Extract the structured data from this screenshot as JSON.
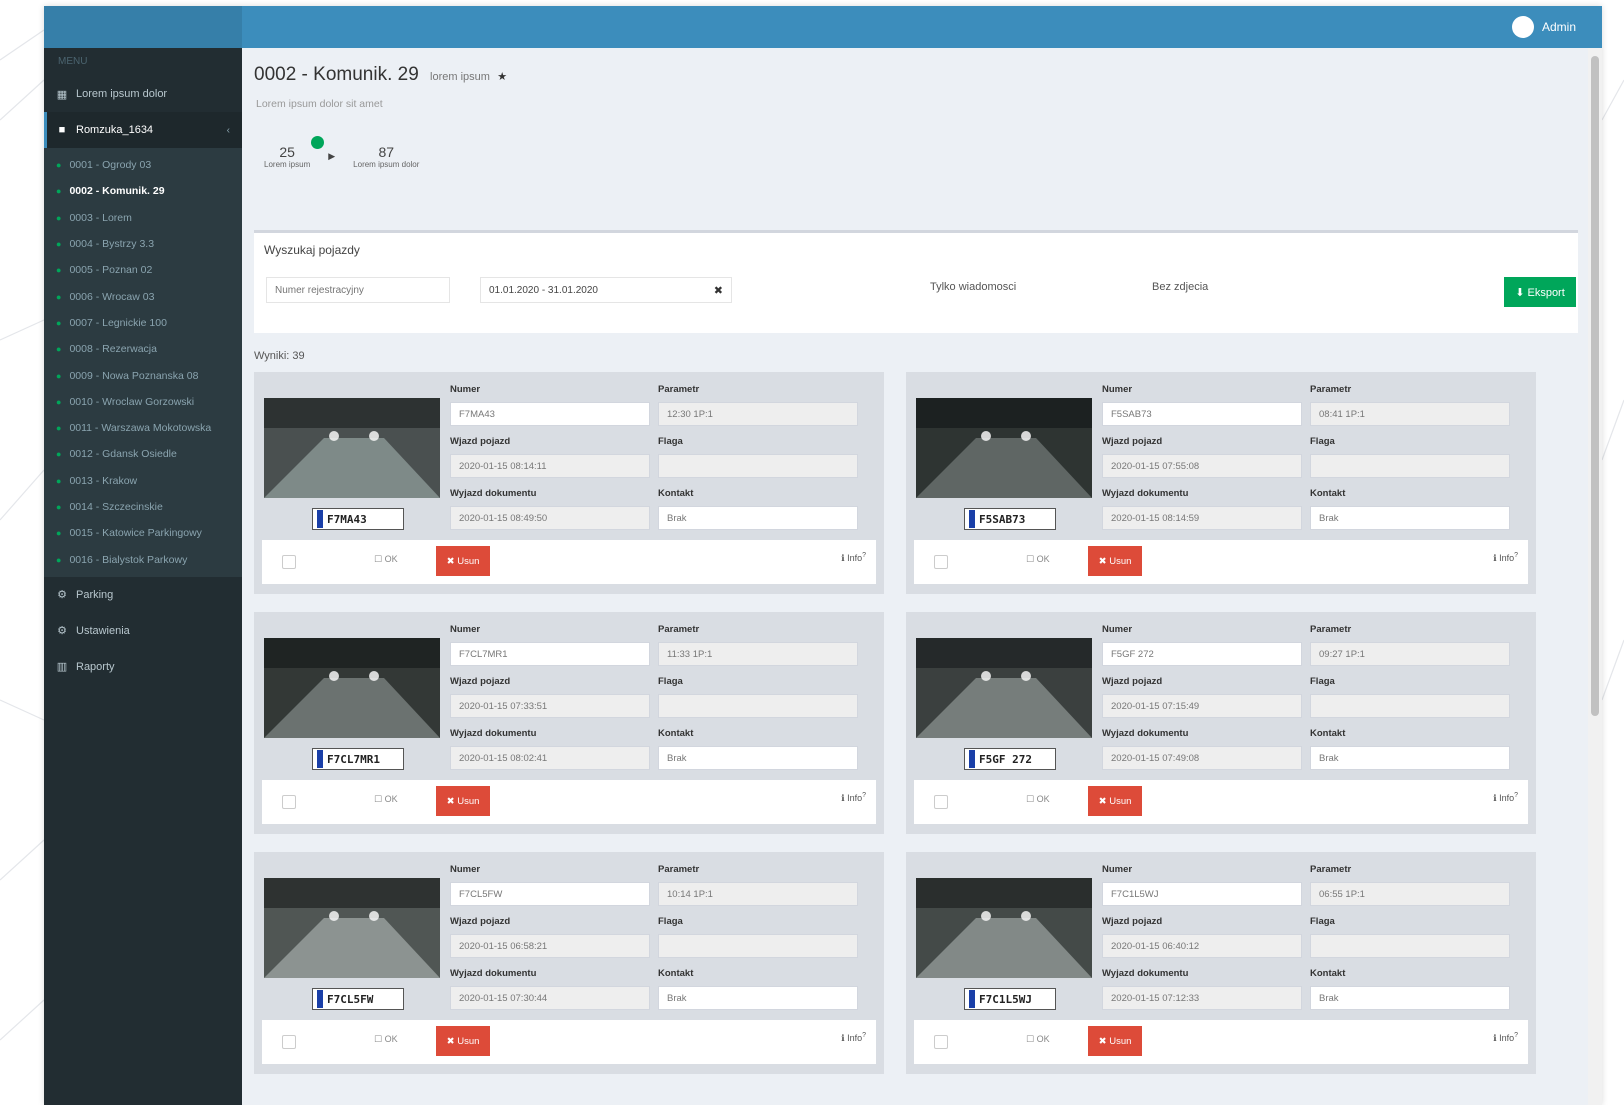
{
  "topbar": {
    "user_name": "Admin"
  },
  "sidebar": {
    "header": "MENU",
    "items": [
      {
        "label": "Lorem ipsum dolor",
        "icon": "dashboard-icon"
      },
      {
        "label": "Romzuka_1634",
        "icon": "folder-icon",
        "caret": "‹"
      }
    ],
    "sub_items": [
      "0001 - Ogrody 03",
      "0002 - Komunik. 29",
      "0003 - Lorem",
      "0004 - Bystrzy 3.3",
      "0005 - Poznan 02",
      "0006 - Wrocaw 03",
      "0007 - Legnickie 100",
      "0008 - Rezerwacja",
      "0009 - Nowa Poznanska 08",
      "0010 - Wroclaw Gorzowski",
      "0011 - Warszawa Mokotowska",
      "0012 - Gdansk Osiedle",
      "0013 - Krakow",
      "0014 - Szczecinskie",
      "0015 - Katowice Parkingowy",
      "0016 - Bialystok Parkowy"
    ],
    "bottom_items": [
      {
        "label": "Parking",
        "icon": "gear-icon"
      },
      {
        "label": "Ustawienia",
        "icon": "gear-icon"
      },
      {
        "label": "Raporty",
        "icon": "chart-icon"
      }
    ]
  },
  "page": {
    "title": "0002 - Komunik. 29",
    "title_small": "lorem ipsum",
    "subtitle": "Lorem ipsum dolor sit amet",
    "workflow": [
      {
        "num": "25",
        "label": "Lorem ipsum"
      },
      {
        "num": "87",
        "label": "Lorem ipsum dolor"
      }
    ]
  },
  "filter": {
    "title": "Wyszukaj pojazdy",
    "search_placeholder": "Numer rejestracyjny",
    "date_range": "01.01.2020 - 31.01.2020",
    "option1": "Tylko wiadomosci",
    "option2": "Bez zdjecia",
    "export_label": "Eksport"
  },
  "results_label": "Wyniki: 39",
  "labels": {
    "field1": "Numer",
    "field2": "Parametr",
    "field3": "Wjazd pojazd",
    "field4": "Flaga",
    "field5": "Wyjazd dokumentu",
    "field6": "Kontakt",
    "ok": "OK",
    "delete": "Usun",
    "info": "Info",
    "comment_placeholder": "Brak"
  },
  "cards": [
    {
      "plate": "F7MA43",
      "number": "F7MA43",
      "param": "12:30 1P:1",
      "entry": "2020-01-15 08:14:11",
      "flag": "",
      "exit": "2020-01-15 08:49:50"
    },
    {
      "plate": "F5SAB73",
      "number": "F5SAB73",
      "param": "08:41 1P:1",
      "entry": "2020-01-15 07:55:08",
      "flag": "",
      "exit": "2020-01-15 08:14:59"
    },
    {
      "plate": "F7CL7MR1",
      "number": "F7CL7MR1",
      "param": "11:33 1P:1",
      "entry": "2020-01-15 07:33:51",
      "flag": "",
      "exit": "2020-01-15 08:02:41"
    },
    {
      "plate": "F5GF 272",
      "number": "F5GF 272",
      "param": "09:27 1P:1",
      "entry": "2020-01-15 07:15:49",
      "flag": "",
      "exit": "2020-01-15 07:49:08"
    },
    {
      "plate": "F7CL5FW",
      "number": "F7CL5FW",
      "param": "10:14 1P:1",
      "entry": "2020-01-15 06:58:21",
      "flag": "",
      "exit": "2020-01-15 07:30:44"
    },
    {
      "plate": "F7C1L5WJ",
      "number": "F7C1L5WJ",
      "param": "06:55 1P:1",
      "entry": "2020-01-15 06:40:12",
      "flag": "",
      "exit": "2020-01-15 07:12:33"
    }
  ],
  "colors": {
    "topbar": "#3c8dbc",
    "sidebar": "#222d32",
    "export": "#00a65a",
    "delete": "#dd4b39"
  }
}
